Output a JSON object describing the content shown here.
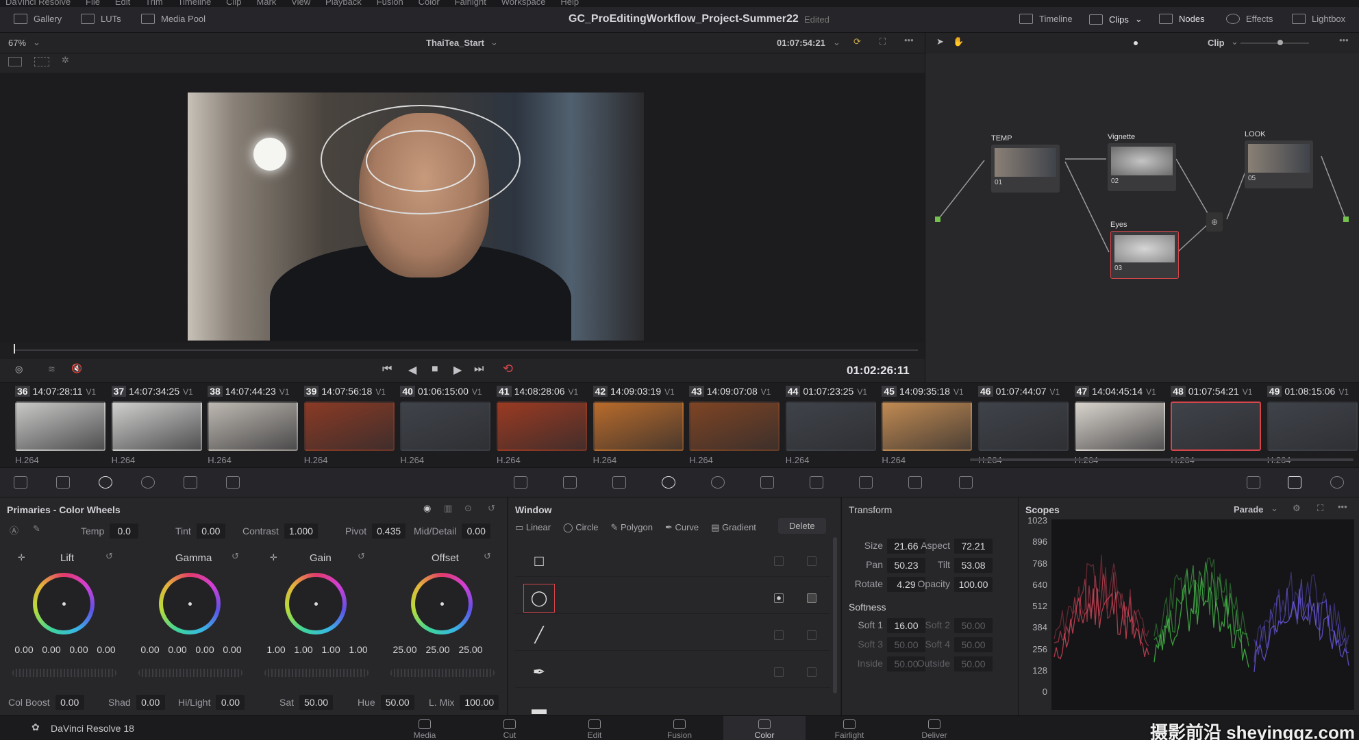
{
  "menu": [
    "DaVinci Resolve",
    "File",
    "Edit",
    "Trim",
    "Timeline",
    "Clip",
    "Mark",
    "View",
    "Playback",
    "Fusion",
    "Color",
    "Fairlight",
    "Workspace",
    "Help"
  ],
  "toolbar": {
    "gallery": "Gallery",
    "luts": "LUTs",
    "media_pool": "Media Pool",
    "project_title": "GC_ProEditingWorkflow_Project-Summer22",
    "edited": "Edited",
    "timeline": "Timeline",
    "clips": "Clips",
    "nodes": "Nodes",
    "effects": "Effects",
    "lightbox": "Lightbox"
  },
  "viewer": {
    "zoom": "67%",
    "clip_name": "ThaiTea_Start",
    "timecode": "01:07:54:21",
    "mode": "Clip",
    "playhead_tc": "01:02:26:11",
    "playhead_fraction": 0.0
  },
  "nodes": [
    {
      "label": "TEMP",
      "num": "01"
    },
    {
      "label": "Vignette",
      "num": "02"
    },
    {
      "label": "Eyes",
      "num": "03"
    },
    {
      "label": "LOOK",
      "num": "05"
    }
  ],
  "clips": [
    {
      "num": "36",
      "tc": "14:07:28:11",
      "track": "V1",
      "codec": "H.264",
      "color": "#c8c8c6"
    },
    {
      "num": "37",
      "tc": "14:07:34:25",
      "track": "V1",
      "codec": "H.264",
      "color": "#cfcfcd"
    },
    {
      "num": "38",
      "tc": "14:07:44:23",
      "track": "V1",
      "codec": "H.264",
      "color": "#bdb8b1"
    },
    {
      "num": "39",
      "tc": "14:07:56:18",
      "track": "V1",
      "codec": "H.264",
      "color": "#8a3a25"
    },
    {
      "num": "40",
      "tc": "01:06:15:00",
      "track": "V1",
      "codec": "H.264",
      "color": "#3f434a"
    },
    {
      "num": "41",
      "tc": "14:08:28:06",
      "track": "V1",
      "codec": "H.264",
      "color": "#9a3a22"
    },
    {
      "num": "42",
      "tc": "14:09:03:19",
      "track": "V1",
      "codec": "H.264",
      "color": "#b86b2b"
    },
    {
      "num": "43",
      "tc": "14:09:07:08",
      "track": "V1",
      "codec": "H.264",
      "color": "#7e4424"
    },
    {
      "num": "44",
      "tc": "01:07:23:25",
      "track": "V1",
      "codec": "H.264",
      "color": "#3f434a"
    },
    {
      "num": "45",
      "tc": "14:09:35:18",
      "track": "V1",
      "codec": "H.264",
      "color": "#c08a52"
    },
    {
      "num": "46",
      "tc": "01:07:44:07",
      "track": "V1",
      "codec": "H.264",
      "color": "#3f434a"
    },
    {
      "num": "47",
      "tc": "14:04:45:14",
      "track": "V1",
      "codec": "H.264",
      "color": "#d8d3cc"
    },
    {
      "num": "48",
      "tc": "01:07:54:21",
      "track": "V1",
      "codec": "H.264",
      "color": "#3f434a",
      "selected": true
    },
    {
      "num": "49",
      "tc": "01:08:15:06",
      "track": "V1",
      "codec": "H.264",
      "color": "#3f434a"
    }
  ],
  "primaries": {
    "title": "Primaries - Color Wheels",
    "temp_label": "Temp",
    "temp": "0.0",
    "tint_label": "Tint",
    "tint": "0.00",
    "contrast_label": "Contrast",
    "contrast": "1.000",
    "pivot_label": "Pivot",
    "pivot": "0.435",
    "middetail_label": "Mid/Detail",
    "middetail": "0.00",
    "wheels": [
      {
        "label": "Lift",
        "values": [
          "0.00",
          "0.00",
          "0.00",
          "0.00"
        ]
      },
      {
        "label": "Gamma",
        "values": [
          "0.00",
          "0.00",
          "0.00",
          "0.00"
        ]
      },
      {
        "label": "Gain",
        "values": [
          "1.00",
          "1.00",
          "1.00",
          "1.00"
        ]
      },
      {
        "label": "Offset",
        "values": [
          "25.00",
          "25.00",
          "25.00"
        ]
      }
    ],
    "colboost_label": "Col Boost",
    "colboost": "0.00",
    "shad_label": "Shad",
    "shad": "0.00",
    "hilight_label": "Hi/Light",
    "hilight": "0.00",
    "sat_label": "Sat",
    "sat": "50.00",
    "hue_label": "Hue",
    "hue": "50.00",
    "lmix_label": "L. Mix",
    "lmix": "100.00"
  },
  "window": {
    "title": "Window",
    "shapes": [
      "Linear",
      "Circle",
      "Polygon",
      "Curve",
      "Gradient"
    ],
    "delete": "Delete"
  },
  "transform": {
    "title": "Transform",
    "size_label": "Size",
    "size": "21.66",
    "aspect_label": "Aspect",
    "aspect": "72.21",
    "pan_label": "Pan",
    "pan": "50.23",
    "tilt_label": "Tilt",
    "tilt": "53.08",
    "rotate_label": "Rotate",
    "rotate": "4.29",
    "opacity_label": "Opacity",
    "opacity": "100.00",
    "softness_title": "Softness",
    "soft1_label": "Soft 1",
    "soft1": "16.00",
    "soft2_label": "Soft 2",
    "soft2": "50.00",
    "soft3_label": "Soft 3",
    "soft3": "50.00",
    "soft4_label": "Soft 4",
    "soft4": "50.00",
    "inside_label": "Inside",
    "inside": "50.00",
    "outside_label": "Outside",
    "outside": "50.00"
  },
  "scopes": {
    "title": "Scopes",
    "mode": "Parade",
    "ticks": [
      "1023",
      "896",
      "768",
      "640",
      "512",
      "384",
      "256",
      "128",
      "0"
    ]
  },
  "bottom": {
    "app": "DaVinci Resolve 18",
    "pages": [
      "Media",
      "Cut",
      "Edit",
      "Fusion",
      "Color",
      "Fairlight",
      "Deliver"
    ],
    "active_page": "Color"
  },
  "watermark": "摄影前沿 sheyingqz.com"
}
